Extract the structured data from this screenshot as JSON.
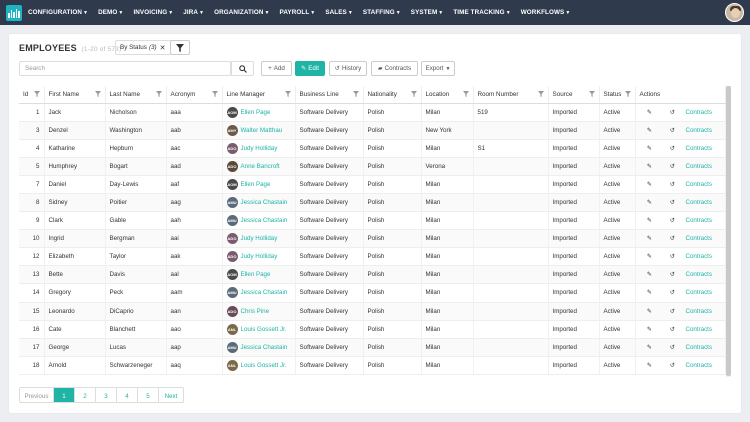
{
  "nav": {
    "items": [
      "CONFIGURATION",
      "DEMO",
      "INVOICING",
      "JIRA",
      "ORGANIZATION",
      "PAYROLL",
      "SALES",
      "STAFFING",
      "SYSTEM",
      "TIME TRACKING",
      "WORKFLOWS"
    ]
  },
  "header": {
    "title": "EMPLOYEES",
    "range": "(1-20 of 573)",
    "filter_chip": "By Status",
    "filter_count": "(3)"
  },
  "toolbar": {
    "search_placeholder": "Search",
    "add_label": "Add",
    "edit_label": "Edit",
    "history_label": "History",
    "contracts_label": "Contracts",
    "export_label": "Export"
  },
  "table": {
    "columns": [
      "Id",
      "First Name",
      "Last Name",
      "Acronym",
      "Line Manager",
      "Business Line",
      "Nationality",
      "Location",
      "Room Number",
      "Source",
      "Status",
      "Actions"
    ],
    "rows": [
      {
        "id": "1",
        "first": "Jack",
        "last": "Nicholson",
        "acr": "aaa",
        "mgr": "Ellen Page",
        "mgr_init": "AOM",
        "mgr_color": "#4a4a4a",
        "bl": "Software Delivery",
        "nat": "Polish",
        "loc": "Milan",
        "room": "519",
        "src": "Imported",
        "status": "Active",
        "contracts": "Contracts"
      },
      {
        "id": "3",
        "first": "Denzel",
        "last": "Washington",
        "acr": "aab",
        "mgr": "Walter Matthau",
        "mgr_init": "AMY",
        "mgr_color": "#6b5a4a",
        "bl": "Software Delivery",
        "nat": "Polish",
        "loc": "New York",
        "room": "",
        "src": "Imported",
        "status": "Active",
        "contracts": "Contracts"
      },
      {
        "id": "4",
        "first": "Katharine",
        "last": "Hepburn",
        "acr": "aac",
        "mgr": "Judy Holliday",
        "mgr_init": "ADO",
        "mgr_color": "#7a5c6e",
        "bl": "Software Delivery",
        "nat": "Polish",
        "loc": "Milan",
        "room": "S1",
        "src": "Imported",
        "status": "Active",
        "contracts": "Contracts"
      },
      {
        "id": "5",
        "first": "Humphrey",
        "last": "Bogart",
        "acr": "aad",
        "mgr": "Anne Bancroft",
        "mgr_init": "ADO",
        "mgr_color": "#5a4a3a",
        "bl": "Software Delivery",
        "nat": "Polish",
        "loc": "Verona",
        "room": "",
        "src": "Imported",
        "status": "Active",
        "contracts": "Contracts"
      },
      {
        "id": "7",
        "first": "Daniel",
        "last": "Day-Lewis",
        "acr": "aaf",
        "mgr": "Ellen Page",
        "mgr_init": "AOM",
        "mgr_color": "#4a4a4a",
        "bl": "Software Delivery",
        "nat": "Polish",
        "loc": "Milan",
        "room": "",
        "src": "Imported",
        "status": "Active",
        "contracts": "Contracts"
      },
      {
        "id": "8",
        "first": "Sidney",
        "last": "Poitier",
        "acr": "aag",
        "mgr": "Jessica Chastain",
        "mgr_init": "AMU",
        "mgr_color": "#5a6a7a",
        "bl": "Software Delivery",
        "nat": "Polish",
        "loc": "Milan",
        "room": "",
        "src": "Imported",
        "status": "Active",
        "contracts": "Contracts"
      },
      {
        "id": "9",
        "first": "Clark",
        "last": "Gable",
        "acr": "aah",
        "mgr": "Jessica Chastain",
        "mgr_init": "AMU",
        "mgr_color": "#5a6a7a",
        "bl": "Software Delivery",
        "nat": "Polish",
        "loc": "Milan",
        "room": "",
        "src": "Imported",
        "status": "Active",
        "contracts": "Contracts"
      },
      {
        "id": "10",
        "first": "Ingrid",
        "last": "Bergman",
        "acr": "aai",
        "mgr": "Judy Holliday",
        "mgr_init": "ADO",
        "mgr_color": "#7a5c6e",
        "bl": "Software Delivery",
        "nat": "Polish",
        "loc": "Milan",
        "room": "",
        "src": "Imported",
        "status": "Active",
        "contracts": "Contracts"
      },
      {
        "id": "12",
        "first": "Elizabeth",
        "last": "Taylor",
        "acr": "aak",
        "mgr": "Judy Holliday",
        "mgr_init": "ADO",
        "mgr_color": "#7a5c6e",
        "bl": "Software Delivery",
        "nat": "Polish",
        "loc": "Milan",
        "room": "",
        "src": "Imported",
        "status": "Active",
        "contracts": "Contracts"
      },
      {
        "id": "13",
        "first": "Bette",
        "last": "Davis",
        "acr": "aal",
        "mgr": "Ellen Page",
        "mgr_init": "AOM",
        "mgr_color": "#4a4a4a",
        "bl": "Software Delivery",
        "nat": "Polish",
        "loc": "Milan",
        "room": "",
        "src": "Imported",
        "status": "Active",
        "contracts": "Contracts"
      },
      {
        "id": "14",
        "first": "Gregory",
        "last": "Peck",
        "acr": "aam",
        "mgr": "Jessica Chastain",
        "mgr_init": "AMU",
        "mgr_color": "#5a6a7a",
        "bl": "Software Delivery",
        "nat": "Polish",
        "loc": "Milan",
        "room": "",
        "src": "Imported",
        "status": "Active",
        "contracts": "Contracts"
      },
      {
        "id": "15",
        "first": "Leonardo",
        "last": "DiCaprio",
        "acr": "aan",
        "mgr": "Chris Pine",
        "mgr_init": "ADO",
        "mgr_color": "#6a4a5a",
        "bl": "Software Delivery",
        "nat": "Polish",
        "loc": "Milan",
        "room": "",
        "src": "Imported",
        "status": "Active",
        "contracts": "Contracts"
      },
      {
        "id": "16",
        "first": "Cate",
        "last": "Blanchett",
        "acr": "aao",
        "mgr": "Louis Gossett Jr.",
        "mgr_init": "ANL",
        "mgr_color": "#7a6a4a",
        "bl": "Software Delivery",
        "nat": "Polish",
        "loc": "Milan",
        "room": "",
        "src": "Imported",
        "status": "Active",
        "contracts": "Contracts"
      },
      {
        "id": "17",
        "first": "George",
        "last": "Lucas",
        "acr": "aap",
        "mgr": "Jessica Chastain",
        "mgr_init": "AMU",
        "mgr_color": "#5a6a7a",
        "bl": "Software Delivery",
        "nat": "Polish",
        "loc": "Milan",
        "room": "",
        "src": "Imported",
        "status": "Active",
        "contracts": "Contracts"
      },
      {
        "id": "18",
        "first": "Arnold",
        "last": "Schwarzeneger",
        "acr": "aaq",
        "mgr": "Louis Gossett Jr.",
        "mgr_init": "ANL",
        "mgr_color": "#7a6a4a",
        "bl": "Software Delivery",
        "nat": "Polish",
        "loc": "Milan",
        "room": "",
        "src": "Imported",
        "status": "Active",
        "contracts": "Contracts"
      }
    ]
  },
  "pager": {
    "prev": "Previous",
    "pages": [
      "1",
      "2",
      "3",
      "4",
      "5"
    ],
    "next": "Next"
  },
  "colors": {
    "accent": "#1fb4a6",
    "nav_bg": "#2f3b4c"
  }
}
